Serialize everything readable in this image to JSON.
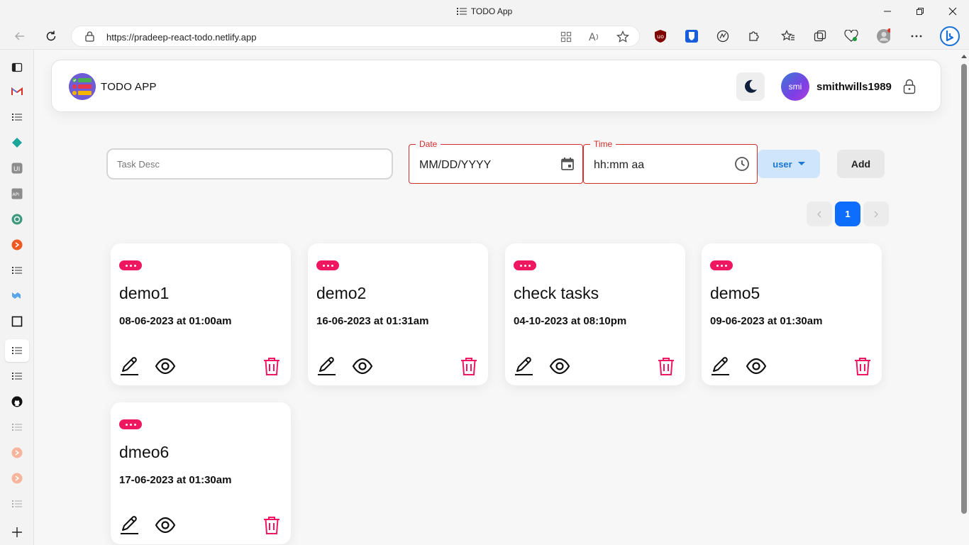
{
  "browser": {
    "window_title": "TODO App",
    "url": "https://pradeep-react-todo.netlify.app"
  },
  "header": {
    "app_title": "TODO APP",
    "avatar_initials": "smi",
    "username": "smithwills1989"
  },
  "form": {
    "task_placeholder": "Task Desc",
    "date_label": "Date",
    "date_placeholder": "MM/DD/YYYY",
    "time_label": "Time",
    "time_placeholder": "hh:mm aa",
    "user_button": "user",
    "add_button": "Add"
  },
  "pagination": {
    "current_page": "1"
  },
  "tasks": [
    {
      "title": "demo1",
      "datetime": "08-06-2023 at 01:00am"
    },
    {
      "title": "demo2",
      "datetime": "16-06-2023 at 01:31am"
    },
    {
      "title": "check tasks",
      "datetime": "04-10-2023 at 08:10pm"
    },
    {
      "title": "demo5",
      "datetime": "09-06-2023 at 01:30am"
    },
    {
      "title": "dmeo6",
      "datetime": "17-06-2023 at 01:30am"
    }
  ],
  "colors": {
    "accent_pink": "#ef1760",
    "error_red": "#d32f2f",
    "primary_blue": "#0d6efd",
    "user_button_bg": "#cfe5fb"
  }
}
